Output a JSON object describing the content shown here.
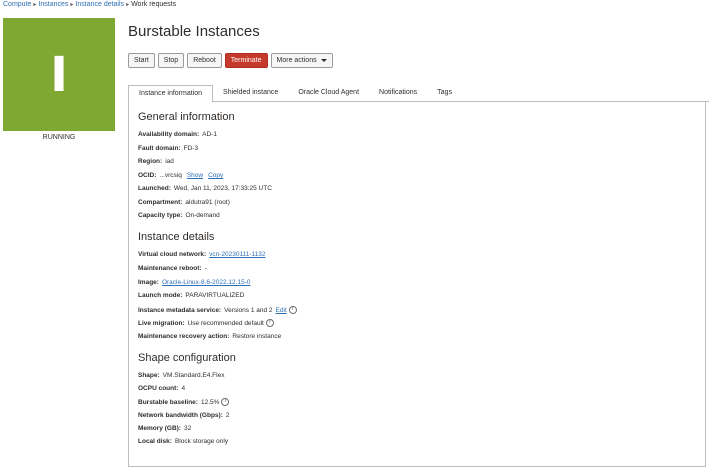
{
  "breadcrumb": {
    "items": [
      "Compute",
      "Instances",
      "Instance details"
    ],
    "separator": "▸",
    "current": "Work requests"
  },
  "status": {
    "letter": "I",
    "label": "RUNNING",
    "color": "#7fa833"
  },
  "title": "Burstable Instances",
  "actions": {
    "start": "Start",
    "stop": "Stop",
    "reboot": "Reboot",
    "terminate": "Terminate",
    "more": "More actions"
  },
  "tabs": [
    "Instance information",
    "Shielded instance",
    "Oracle Cloud Agent",
    "Notifications",
    "Tags"
  ],
  "general": {
    "title": "General information",
    "availability_domain": {
      "label": "Availability domain:",
      "value": "AD-1"
    },
    "fault_domain": {
      "label": "Fault domain:",
      "value": "FD-3"
    },
    "region": {
      "label": "Region:",
      "value": "iad"
    },
    "ocid": {
      "label": "OCID:",
      "value": "...vrcsiq",
      "show": "Show",
      "copy": "Copy"
    },
    "launched": {
      "label": "Launched:",
      "value": "Wed, Jan 11, 2023, 17:33:25 UTC"
    },
    "compartment": {
      "label": "Compartment:",
      "value": "aldutra91 (root)"
    },
    "capacity_type": {
      "label": "Capacity type:",
      "value": "On-demand"
    }
  },
  "details": {
    "title": "Instance details",
    "vcn": {
      "label": "Virtual cloud network:",
      "value": "vcn-20230111-1132"
    },
    "maintenance_reboot": {
      "label": "Maintenance reboot:",
      "value": "-"
    },
    "image": {
      "label": "Image:",
      "value": "Oracle-Linux-8.6-2022.12.15-0"
    },
    "launch_mode": {
      "label": "Launch mode:",
      "value": "PARAVIRTUALIZED"
    },
    "metadata_service": {
      "label": "Instance metadata service:",
      "value": "Versions 1 and 2",
      "edit": "Edit"
    },
    "live_migration": {
      "label": "Live migration:",
      "value": "Use recommended default"
    },
    "recovery_action": {
      "label": "Maintenance recovery action:",
      "value": "Restore instance"
    }
  },
  "shape": {
    "title": "Shape configuration",
    "shape": {
      "label": "Shape:",
      "value": "VM.Standard.E4.Flex"
    },
    "ocpu": {
      "label": "OCPU count:",
      "value": "4"
    },
    "burstable": {
      "label": "Burstable baseline:",
      "value": "12.5%"
    },
    "bandwidth": {
      "label": "Network bandwidth (Gbps):",
      "value": "2"
    },
    "memory": {
      "label": "Memory (GB):",
      "value": "32"
    },
    "local_disk": {
      "label": "Local disk:",
      "value": "Block storage only"
    }
  },
  "info_icon_glyph": "i"
}
